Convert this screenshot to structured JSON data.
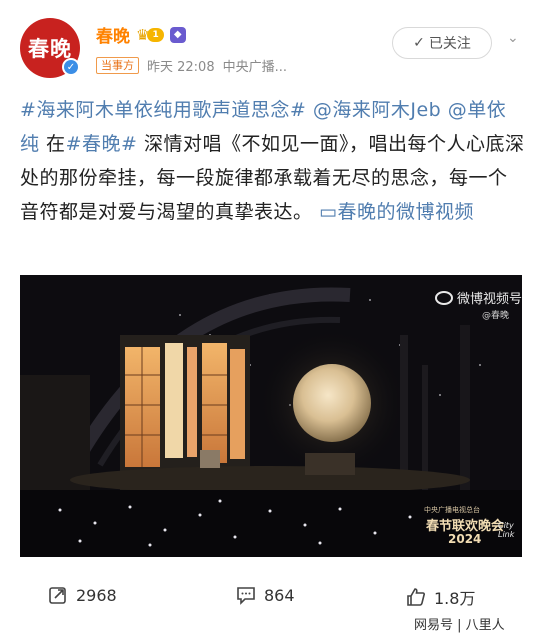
{
  "account": {
    "avatar_text": "春晚",
    "name": "春晚",
    "level": "1",
    "tag": "当事方",
    "time": "昨天 22:08",
    "source": "中央广播...",
    "follow_label": "已关注"
  },
  "post": {
    "segments": [
      {
        "text": "#海来阿木单依纯用歌声道思念#",
        "type": "topic"
      },
      {
        "text": " ",
        "type": "plain"
      },
      {
        "text": "@海来阿木Jeb",
        "type": "topic"
      },
      {
        "text": " ",
        "type": "plain"
      },
      {
        "text": "@单依纯",
        "type": "topic"
      },
      {
        "text": " 在",
        "type": "plain"
      },
      {
        "text": "#春晚#",
        "type": "topic"
      },
      {
        "text": " 深情对唱《不如见一面》，唱出每个人心底深处的那份牵挂，每一段旋律都承载着无尽的思念，每一个音符都是对爱与渴望的真挚表达。 ",
        "type": "plain"
      }
    ],
    "video_link": "春晚的微博视频"
  },
  "video": {
    "watermark": "微博视频号",
    "watermark_sub": "@春晚",
    "gala_line1": "中央广播电视总台",
    "gala_title": "春节联欢晚会",
    "gala_year": "2024",
    "city_link_1": "City",
    "city_link_2": "Link"
  },
  "actions": {
    "repost": "2968",
    "comments": "864",
    "likes": "1.8万"
  },
  "footer": {
    "watermark": "网易号 | 八里人"
  },
  "colors": {
    "brand_orange": "#ff8200",
    "link_blue": "#507daf",
    "avatar_red": "#c8221f"
  }
}
